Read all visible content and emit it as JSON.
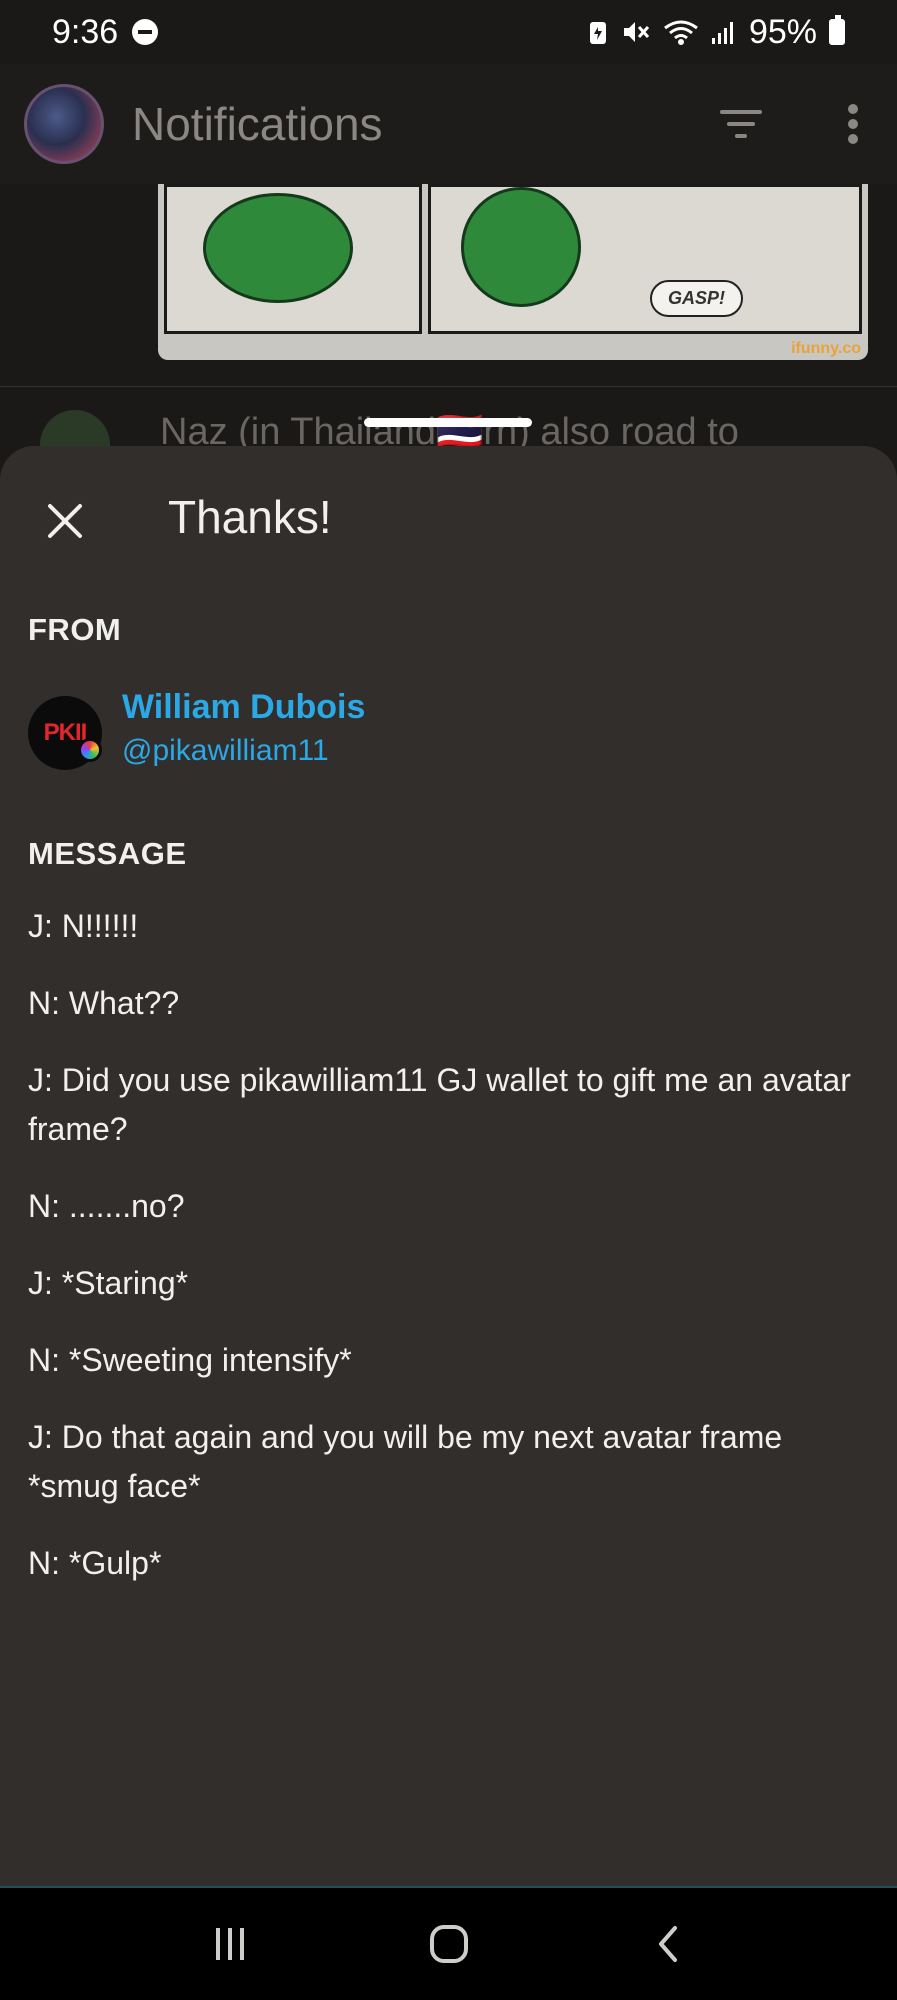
{
  "status_bar": {
    "time": "9:36",
    "battery": "95%",
    "icons": [
      "dnd-icon",
      "battery-saver-icon",
      "mute-icon",
      "wifi-icon",
      "signal-icon",
      "battery-icon"
    ]
  },
  "app_bar": {
    "title": "Notifications",
    "actions": [
      "filter-icon",
      "more-vert-icon"
    ]
  },
  "feed": {
    "comic_bubble": "GASP!",
    "comic_watermark": "ifunny.co",
    "peek_text": "Naz (in Thailand🇹🇭rn) also road to"
  },
  "sheet": {
    "title": "Thanks!",
    "from_label": "FROM",
    "sender": {
      "name": "William Dubois",
      "handle": "@pikawilliam11",
      "avatar_text": "PKII"
    },
    "message_label": "MESSAGE",
    "message_lines": [
      "J: N!!!!!!",
      "N: What??",
      "J: Did you use pikawilliam11 GJ wallet to gift me an avatar frame?",
      "N: .......no?",
      "J: *Staring*",
      "N: *Sweeting intensify*",
      "J: Do that again and you will be my next avatar frame *smug face*",
      "N: *Gulp*"
    ]
  },
  "colors": {
    "sheet_bg": "#312e2b",
    "accent_link": "#2ba8e6",
    "screen_bg": "#1b1918"
  },
  "nav_bar": {
    "buttons": [
      "recent-apps-icon",
      "home-icon",
      "back-icon"
    ]
  }
}
